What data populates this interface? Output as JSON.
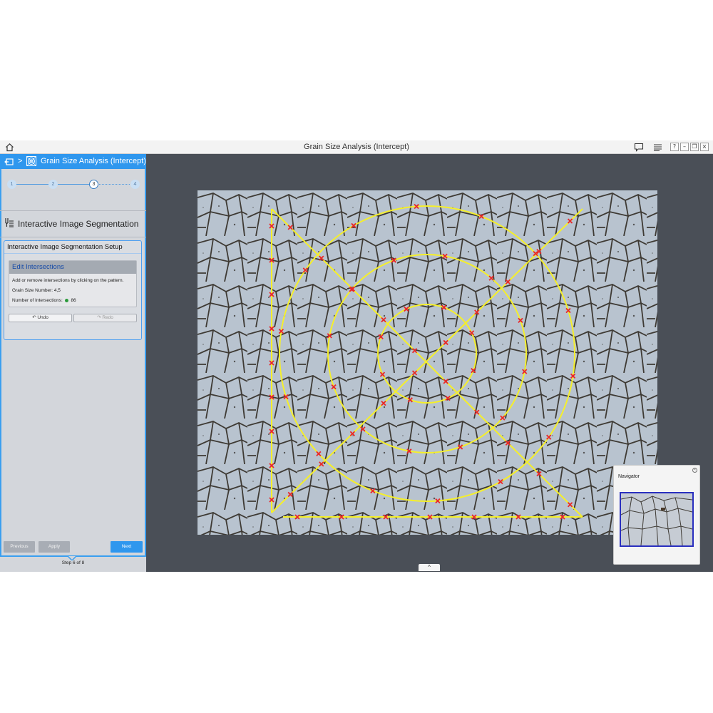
{
  "window": {
    "title": "Grain Size Analysis (Intercept)",
    "home_icon": "home-icon",
    "chat_icon": "chat-icon",
    "menu_icon": "menu-icon",
    "controls": {
      "help": "?",
      "minimize": "–",
      "restore": "❐",
      "close": "×"
    }
  },
  "breadcrumb": {
    "separator": ">",
    "current": "Grain Size Analysis (Intercept)"
  },
  "stepper": {
    "steps": [
      "1",
      "2",
      "3",
      "4"
    ],
    "active_index": 2
  },
  "section": {
    "title": "Interactive Image Segmentation"
  },
  "setup": {
    "title": "Interactive Image Segmentation Setup",
    "edit": {
      "header": "Edit Intersections",
      "instructions": "Add or remove intersections by clicking on the pattern.",
      "grain_size_label": "Grain Size Number:",
      "grain_size_value": "4,5",
      "intersections_label": "Number of Intersections:",
      "intersections_value": "86"
    },
    "undo_label": "Undo",
    "redo_label": "Redo"
  },
  "footer": {
    "previous_label": "Previous",
    "apply_label": "Apply",
    "next_label": "Next",
    "step_counter": "Step 6 of 8"
  },
  "navigator": {
    "title": "Navigator"
  },
  "colors": {
    "accent": "#2f97ee",
    "panel_bg": "#d3d6db",
    "workspace_bg": "#4a4f57",
    "pattern": "#f5ef2a",
    "intersection_marker": "#e8262a"
  }
}
